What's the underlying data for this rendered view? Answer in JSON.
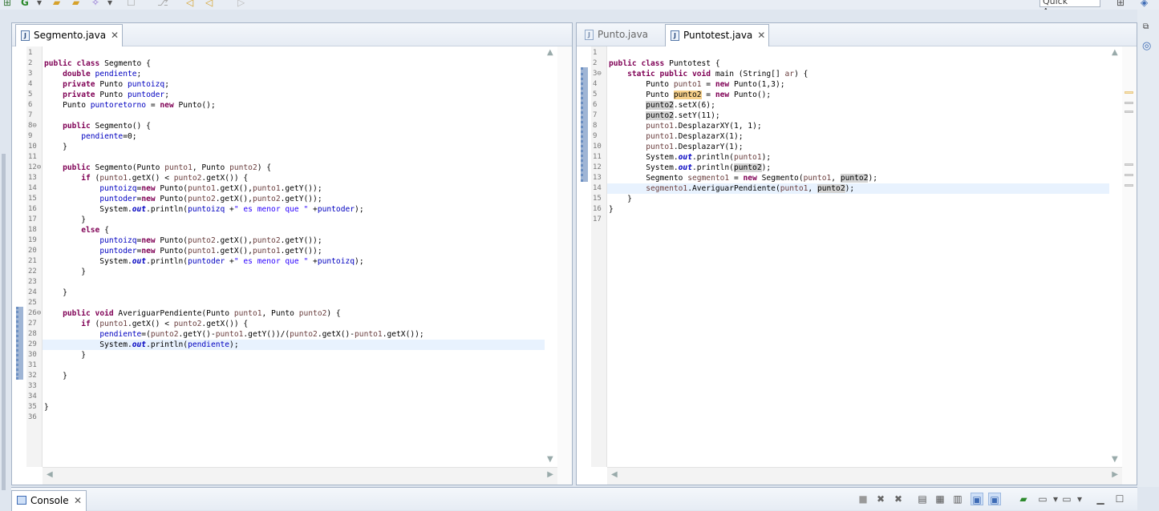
{
  "toolbar": {
    "quick_access_label": "Quick Access"
  },
  "left_editor": {
    "tab_label": "Segmento.java",
    "line_numbers": [
      "1",
      "2",
      "3",
      "4",
      "5",
      "6",
      "7",
      "8⊖",
      "9",
      "10",
      "11",
      "12⊖",
      "13",
      "14",
      "15",
      "16",
      "17",
      "18",
      "19",
      "20",
      "21",
      "22",
      "23",
      "24",
      "25",
      "26⊖",
      "27",
      "28",
      "29",
      "30",
      "31",
      "32",
      "33",
      "34",
      "35",
      "36"
    ]
  },
  "right_editor": {
    "tab_inactive_label": "Punto.java",
    "tab_active_label": "Puntotest.java",
    "line_numbers": [
      "1",
      "2",
      "3⊖",
      "4",
      "5",
      "6",
      "7",
      "8",
      "9",
      "10",
      "11",
      "12",
      "13",
      "14",
      "15",
      "16",
      "17"
    ]
  },
  "console": {
    "tab_label": "Console"
  },
  "colors": {
    "keyword": "#7f0055",
    "field": "#0000c0",
    "string": "#2a00ff",
    "parameter": "#6a3e3e",
    "current_line": "#e8f2fe"
  }
}
